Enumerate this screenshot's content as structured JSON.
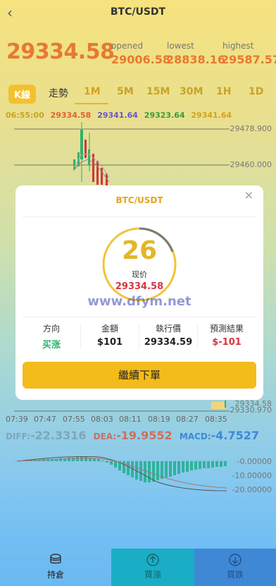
{
  "header": {
    "back_icon": "chevron-left-icon",
    "title": "BTC/USDT"
  },
  "market": {
    "price": "29334.58",
    "opened_label": "opened",
    "opened_value": "29006.58",
    "lowest_label": "lowest",
    "lowest_value": "28838.16",
    "highest_label": "highest",
    "highest_value": "29587.57"
  },
  "tabs": [
    "K線",
    "走勢",
    "1M",
    "5M",
    "15M",
    "30M",
    "1H",
    "1D"
  ],
  "active_tab": "1M",
  "ohlc": {
    "time": "06:55:00",
    "o": "29334.58",
    "h": "29341.64",
    "l": "29323.64",
    "c": "29341.64"
  },
  "price_axis": [
    "29478.900",
    "29460.000",
    "29334.58",
    "29330.970"
  ],
  "time_axis": [
    "07:39",
    "07:47",
    "07:55",
    "08:03",
    "08:11",
    "08:19",
    "08:27",
    "08:35"
  ],
  "macd": {
    "diff_label": "DIFF:",
    "diff_value": "-22.3316",
    "dea_label": "DEA:",
    "dea_value": "-19.9552",
    "macd_label": "MACD:",
    "macd_value": "-4.7527",
    "axis": [
      "-0.00000",
      "-10.00000",
      "-20.00000"
    ]
  },
  "modal": {
    "title": "BTC/USDT",
    "countdown": "26",
    "current_label": "现价",
    "current_price": "29334.58",
    "watermark": "www.dfym.net",
    "cols": [
      {
        "label": "方向",
        "value": "买涨"
      },
      {
        "label": "金額",
        "value": "$101"
      },
      {
        "label": "執行價",
        "value": "29334.59"
      },
      {
        "label": "預測結果",
        "value": "$-101"
      }
    ],
    "continue_label": "繼續下單"
  },
  "bottom_nav": [
    {
      "label": "持倉",
      "icon": "coins-icon"
    },
    {
      "label": "買漲",
      "icon": "arrow-up-circle-icon"
    },
    {
      "label": "買跌",
      "icon": "arrow-down-circle-icon"
    }
  ],
  "colors": {
    "accent": "#f4bc1b",
    "price": "#e67932",
    "up": "#2fb36c",
    "down": "#d8333e"
  }
}
